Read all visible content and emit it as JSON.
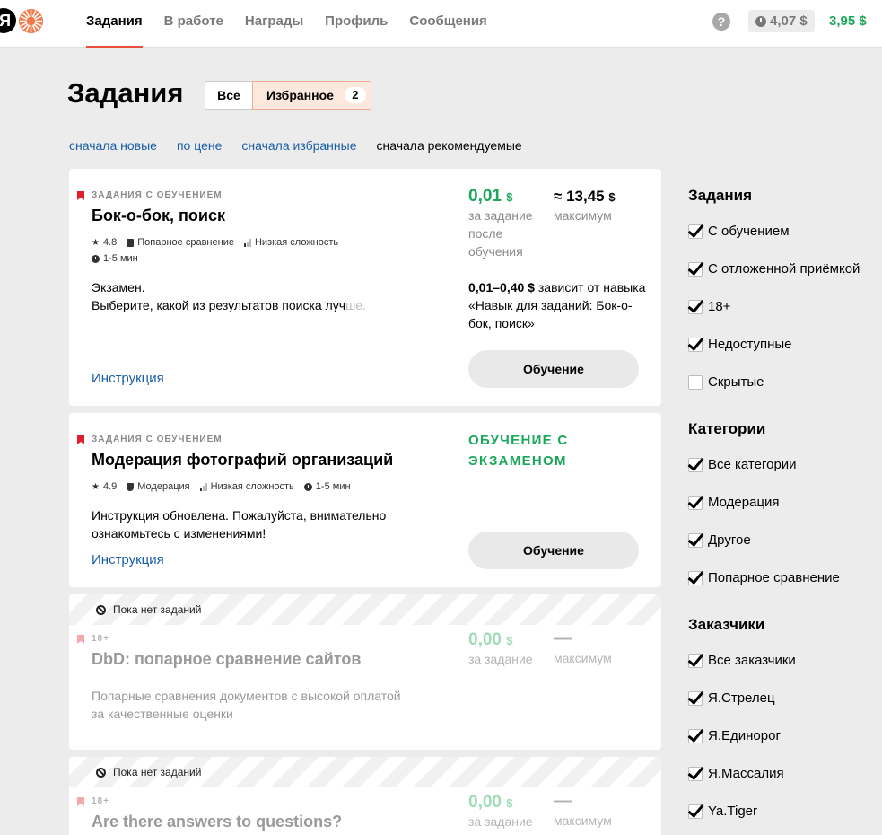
{
  "header": {
    "logo_letter": "Я",
    "nav": [
      "Задания",
      "В работе",
      "Награды",
      "Профиль",
      "Сообщения"
    ],
    "help_label": "?",
    "pending_balance": "4,07 $",
    "balance": "3,95 $"
  },
  "page": {
    "title": "Задания",
    "filter_all": "Все",
    "filter_fav": "Избранное",
    "fav_count": "2",
    "sorts": [
      "сначала новые",
      "по цене",
      "сначала избранные",
      "сначала рекомендуемые"
    ]
  },
  "cards": [
    {
      "kicker": "ЗАДАНИЯ С ОБУЧЕНИЕМ",
      "title": "Бок-о-бок, поиск",
      "rating": "4.8",
      "category": "Попарное сравнение",
      "difficulty": "Низкая сложность",
      "duration": "1-5 мин",
      "desc_line1": "Экзамен.",
      "desc_line2_main": "Выберите, какой из результатов поиска луч",
      "desc_line2_fade": "ше.",
      "instruction": "Инструкция",
      "price": "0,01",
      "price_unit": "$",
      "price_label": "за задание после обучения",
      "max_prefix": "≈",
      "max_value": "13,45",
      "max_unit": "$",
      "max_label": "максимум",
      "range_bold": "0,01–0,40 $",
      "range_text": " зависит от навыка «Навык для заданий: Бок-о-бок, поиск»",
      "button": "Обучение"
    },
    {
      "kicker": "ЗАДАНИЯ С ОБУЧЕНИЕМ",
      "title": "Модерация фотографий организаций",
      "rating": "4.9",
      "category": "Модерация",
      "difficulty": "Низкая сложность",
      "duration": "1-5 мин",
      "desc": "Инструкция обновлена. Пожалуйста, внимательно ознакомьтесь с изменениями!",
      "instruction": "Инструкция",
      "status": "ОБУЧЕНИЕ С ЭКЗАМЕНОМ",
      "button": "Обучение"
    },
    {
      "banner": "Пока нет заданий",
      "kicker": "18+",
      "title": "DbD: попарное сравнение сайтов",
      "desc": "Попарные сравнения документов с высокой оплатой за качественные оценки",
      "price": "0,00",
      "price_unit": "$",
      "price_label": "за задание",
      "max_value": "—",
      "max_label": "максимум"
    },
    {
      "banner": "Пока нет заданий",
      "kicker": "18+",
      "title": "Are there answers to questions?",
      "price": "0,00",
      "price_unit": "$",
      "price_label": "за задание",
      "max_value": "—",
      "max_label": "максимум"
    }
  ],
  "sidebar": {
    "tasks_heading": "Задания",
    "tasks": [
      {
        "label": "С обучением",
        "checked": true
      },
      {
        "label": "С отложенной приёмкой",
        "checked": true
      },
      {
        "label": "18+",
        "checked": true
      },
      {
        "label": "Недоступные",
        "checked": true
      },
      {
        "label": "Скрытые",
        "checked": false
      }
    ],
    "categories_heading": "Категории",
    "categories": [
      {
        "label": "Все категории",
        "checked": true
      },
      {
        "label": "Модерация",
        "checked": true
      },
      {
        "label": "Другое",
        "checked": true
      },
      {
        "label": "Попарное сравнение",
        "checked": true
      }
    ],
    "customers_heading": "Заказчики",
    "customers": [
      {
        "label": "Все заказчики",
        "checked": true
      },
      {
        "label": "Я.Стрелец",
        "checked": true
      },
      {
        "label": "Я.Единорог",
        "checked": true
      },
      {
        "label": "Я.Массалия",
        "checked": true
      },
      {
        "label": "Ya.Tiger",
        "checked": true
      }
    ]
  },
  "colors": {
    "accent": "#e8503a",
    "money_green": "#1aa85a",
    "link_blue": "#1a5ea8",
    "bookmark_red": "#e01e2e"
  }
}
